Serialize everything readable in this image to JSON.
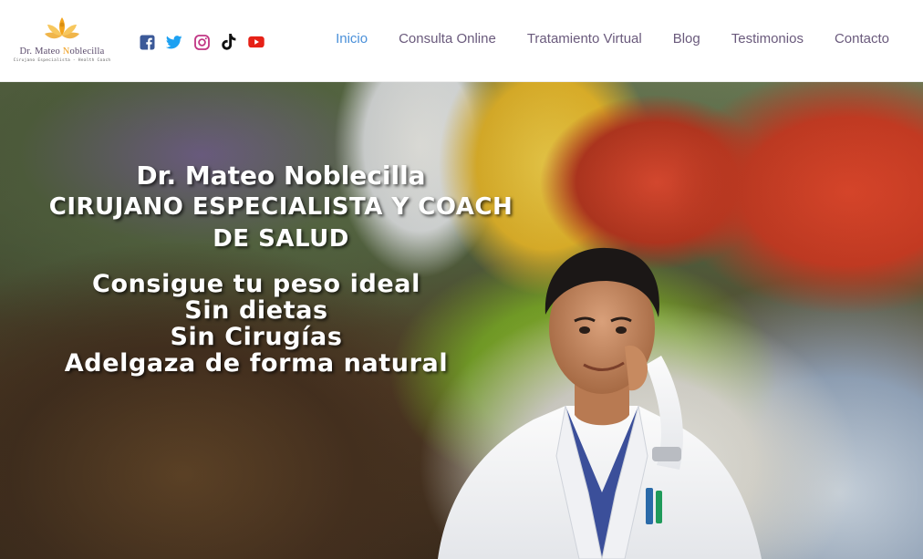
{
  "header": {
    "logo": {
      "name_part1": "Dr. Mateo",
      "name_o": "N",
      "name_part2": "oblecilla",
      "subtitle": "Cirujano Especialista - Health Coach"
    },
    "social": [
      {
        "icon": "facebook-icon",
        "color": "#3b5998"
      },
      {
        "icon": "twitter-icon",
        "color": "#1da1f2"
      },
      {
        "icon": "instagram-icon",
        "color": "#c13584"
      },
      {
        "icon": "tiktok-icon",
        "color": "#111111"
      },
      {
        "icon": "youtube-icon",
        "color": "#e62117"
      }
    ],
    "nav": [
      {
        "label": "Inicio",
        "active": true
      },
      {
        "label": "Consulta Online"
      },
      {
        "label": "Tratamiento Virtual"
      },
      {
        "label": "Blog"
      },
      {
        "label": "Testimonios"
      },
      {
        "label": "Contacto"
      }
    ],
    "nav_color": "#6a5a7c",
    "active_color": "#4a90d9"
  },
  "hero": {
    "title_line1": "Dr. Mateo Noblecilla",
    "title_line2": "CIRUJANO ESPECIALISTA Y COACH",
    "title_line3": "DE SALUD",
    "tagline": [
      "Consigue tu peso ideal",
      "Sin dietas",
      "Sin Cirugías",
      "Adelgaza de forma natural"
    ]
  }
}
